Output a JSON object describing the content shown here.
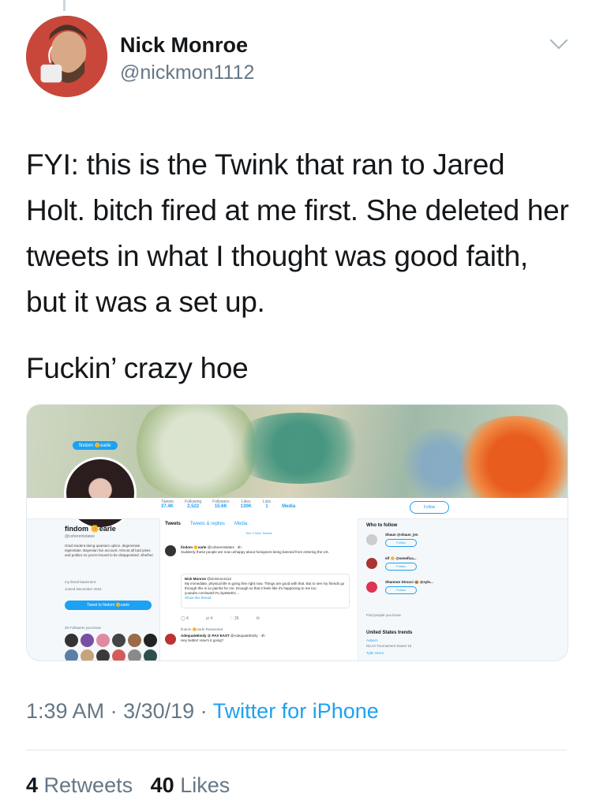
{
  "author": {
    "display_name": "Nick Monroe",
    "handle": "@nickmon1112"
  },
  "tweet": {
    "paragraphs": [
      "FYI: this is the Twink that ran to Jared Holt. bitch fired at me first. She deleted her tweets in what I thought was good faith, but it was a set up.",
      "Fuckin’ crazy hoe"
    ],
    "time": "1:39 AM",
    "date": "3/30/19",
    "source": "Twitter for iPhone",
    "retweets_count": "4",
    "retweets_label": "Retweets",
    "likes_count": "40",
    "likes_label": "Likes"
  },
  "embedded_screenshot": {
    "banner_pill": "findom 🌼earle",
    "stats": [
      {
        "label": "Tweets",
        "value": "37.4K"
      },
      {
        "label": "Following",
        "value": "2,522"
      },
      {
        "label": "Followers",
        "value": "15.6K"
      },
      {
        "label": "Likes",
        "value": "130K"
      },
      {
        "label": "Lists",
        "value": "1"
      },
      {
        "label": "Moments",
        "value": "Media"
      }
    ],
    "follow_label": "Follow",
    "profile": {
      "name": "findom 🌼earle",
      "handle": "@coherentstates",
      "bio": "Grad student doing quantum optics. degenerate eigenstate. Bayesian fan account. Almost all bad jokes and politics so you're bound to be disappointed. She/her",
      "location": "my literal basement",
      "joined": "Joined December 2016",
      "tweet_to": "Tweet to findom 🌼earle",
      "followers_you_know": "25 Followers you know"
    },
    "tabs": [
      "Tweets",
      "Tweets & replies",
      "Media"
    ],
    "new_tweets": "See 2 New Tweets",
    "tweet1": {
      "author": "findom 🌼earle",
      "meta": "@coherentstates · 3h",
      "text": "Suddenly these people are now unhappy about foreigners being banned from entering the US."
    },
    "quoted": {
      "author": "Nick Monroe",
      "meta": "@nickmon1112",
      "text": "My immediate, physical life is going fine right now. Things are good with that. But to see my friends go through this is so painful for me. Enough so that it feels like it's happening to me too. youtube.com/watch?v=kpWarEC...",
      "show_thread": "Show this thread"
    },
    "actions": [
      "4",
      "4",
      "26",
      ""
    ],
    "retweeted_by": "findom 🌼earle Retweeted",
    "tweet2": {
      "author": "AdequateEmily @ PAX EAST",
      "meta": "@AdequateEmily · 4h",
      "text": "Hey twitter! How's it going?"
    },
    "who_to_follow": "Who to follow",
    "suggestions": [
      {
        "name": "Shaun @shaun_jen",
        "button": "Follow"
      },
      {
        "name": "elf 🌼 @venefica...",
        "button": "Follow"
      },
      {
        "name": "Shannon Strucci 🎃 @syle...",
        "button": "Follow"
      }
    ],
    "find_people": "Find people you know",
    "trends_title": "United States trends",
    "trends": [
      "Auburn",
      "NCAA Tournament Sweet 16",
      "Tyler Herro"
    ]
  }
}
